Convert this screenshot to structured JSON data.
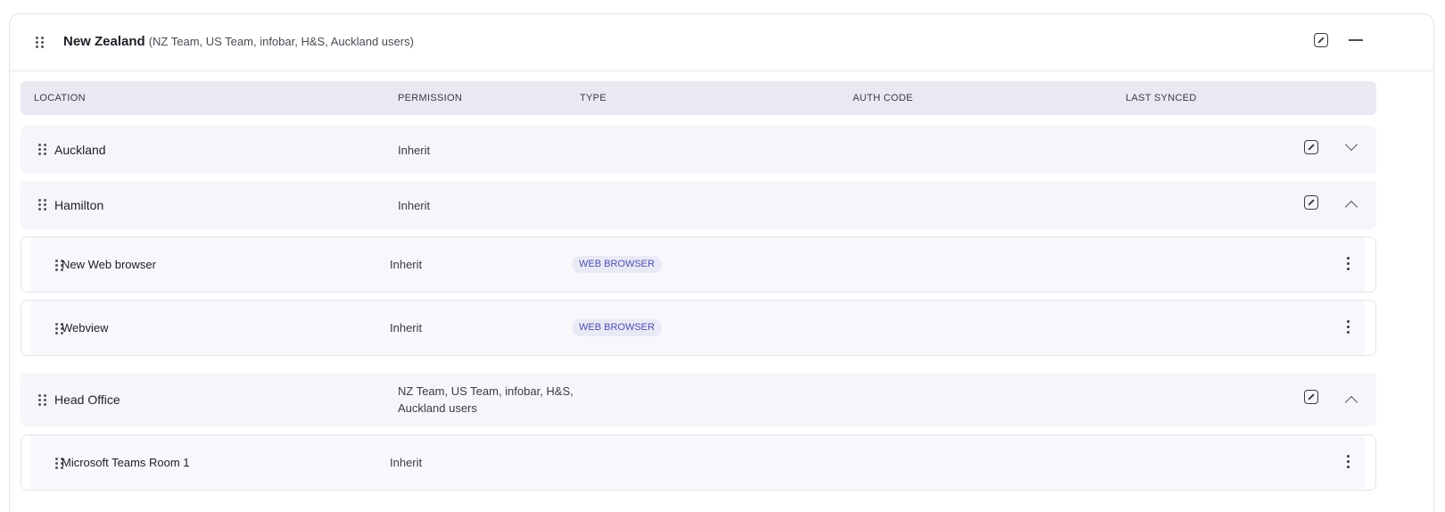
{
  "group": {
    "title": "New Zealand",
    "subtitle": "(NZ Team, US Team, infobar, H&S, Auckland users)"
  },
  "columns": {
    "location": "LOCATION",
    "permission": "PERMISSION",
    "type": "TYPE",
    "auth_code": "AUTH CODE",
    "last_synced": "LAST SYNCED"
  },
  "locations": [
    {
      "name": "Auckland",
      "permission": "Inherit",
      "expanded": false
    },
    {
      "name": "Hamilton",
      "permission": "Inherit",
      "expanded": true
    },
    {
      "name": "Head Office",
      "permission_line1": "NZ Team, US Team, infobar, H&S,",
      "permission_line2": "Auckland users",
      "expanded": true
    }
  ],
  "devices": [
    {
      "name": "New Web browser",
      "permission": "Inherit",
      "type": "WEB BROWSER"
    },
    {
      "name": "Webview",
      "permission": "Inherit",
      "type": "WEB BROWSER"
    },
    {
      "name": "Microsoft Teams Room 1",
      "permission": "Inherit"
    }
  ],
  "icons": [
    "drag-handle-icon",
    "edit-icon",
    "collapse-minus-icon",
    "chevron-down-icon",
    "chevron-up-icon",
    "more-vertical-icon"
  ],
  "colors": {
    "header_bg": "#e9e9f2",
    "row_bg": "#f5f5fb",
    "badge_bg": "#eaeaf6",
    "badge_text": "#4b4fb0"
  }
}
